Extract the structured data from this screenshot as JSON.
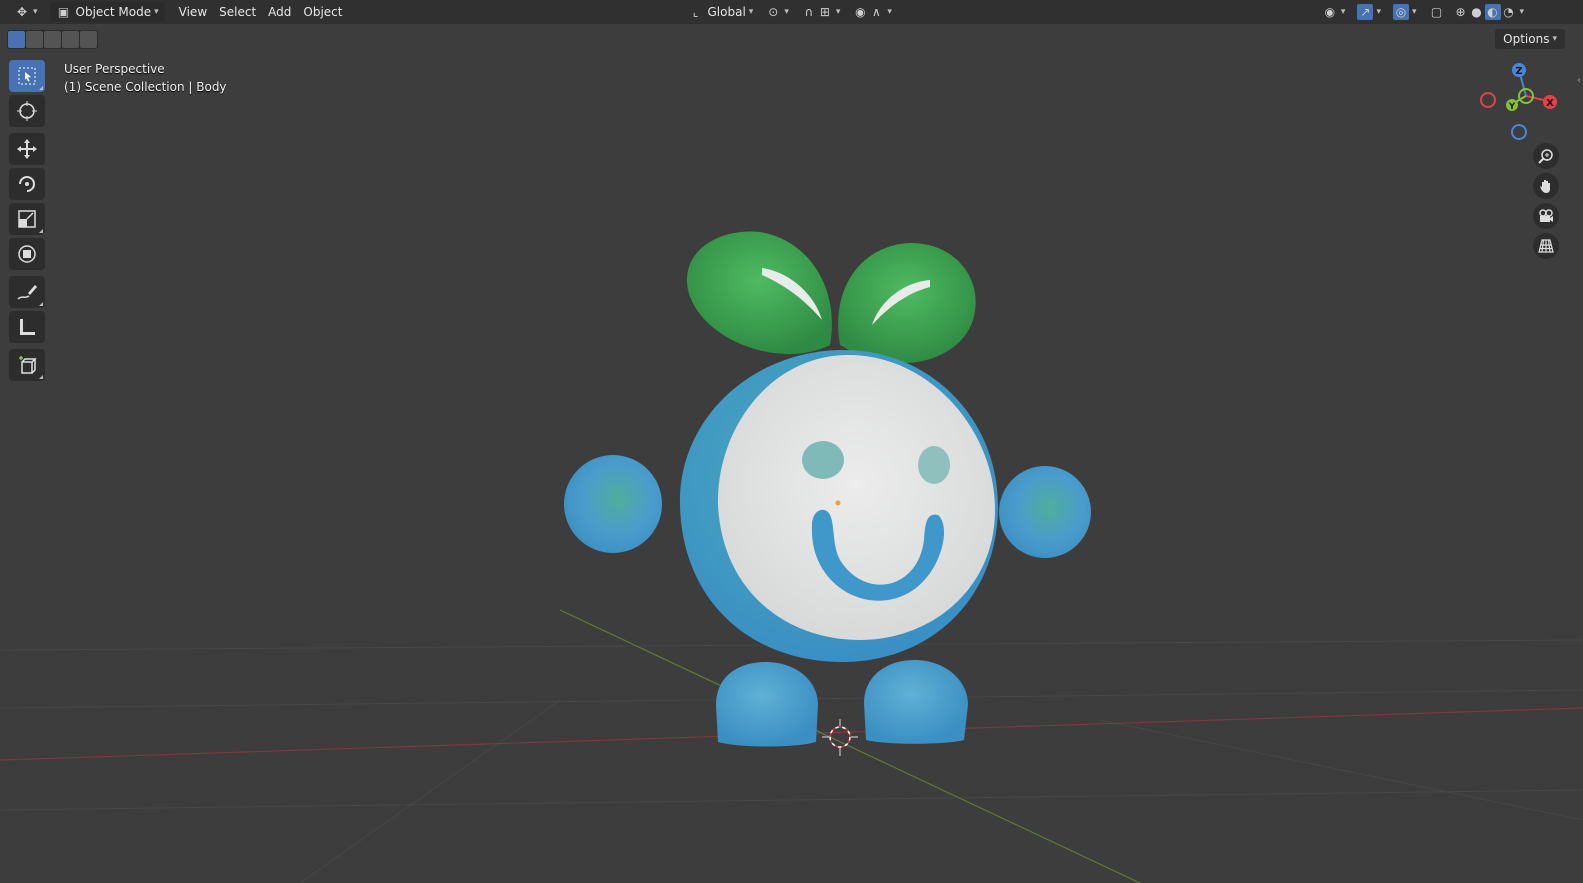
{
  "header": {
    "mode_label": "Object Mode",
    "menus": [
      "View",
      "Select",
      "Add",
      "Object"
    ],
    "transform_orientation": "Global",
    "options_label": "Options"
  },
  "viewport": {
    "perspective_label": "User Perspective",
    "collection_label": "(1) Scene Collection | Body"
  },
  "gizmo": {
    "axes": [
      "X",
      "Y",
      "Z"
    ],
    "colors": {
      "x": "#e0434b",
      "y": "#86bf3a",
      "z": "#4a86d8"
    }
  },
  "toolbar": {
    "tools": [
      "select-box-icon",
      "cursor-icon",
      "move-icon",
      "rotate-icon",
      "scale-icon",
      "transform-icon",
      "annotate-icon",
      "measure-icon",
      "add-cube-icon"
    ],
    "active_tool": "select-box-icon"
  },
  "colors": {
    "viewport_bg": "#3d3d3d",
    "header_bg": "#303030",
    "accent": "#4772b3",
    "leaf_green": "#3ea853",
    "body_blue": "#4a9ccc",
    "face_white": "#e3e5e4"
  }
}
